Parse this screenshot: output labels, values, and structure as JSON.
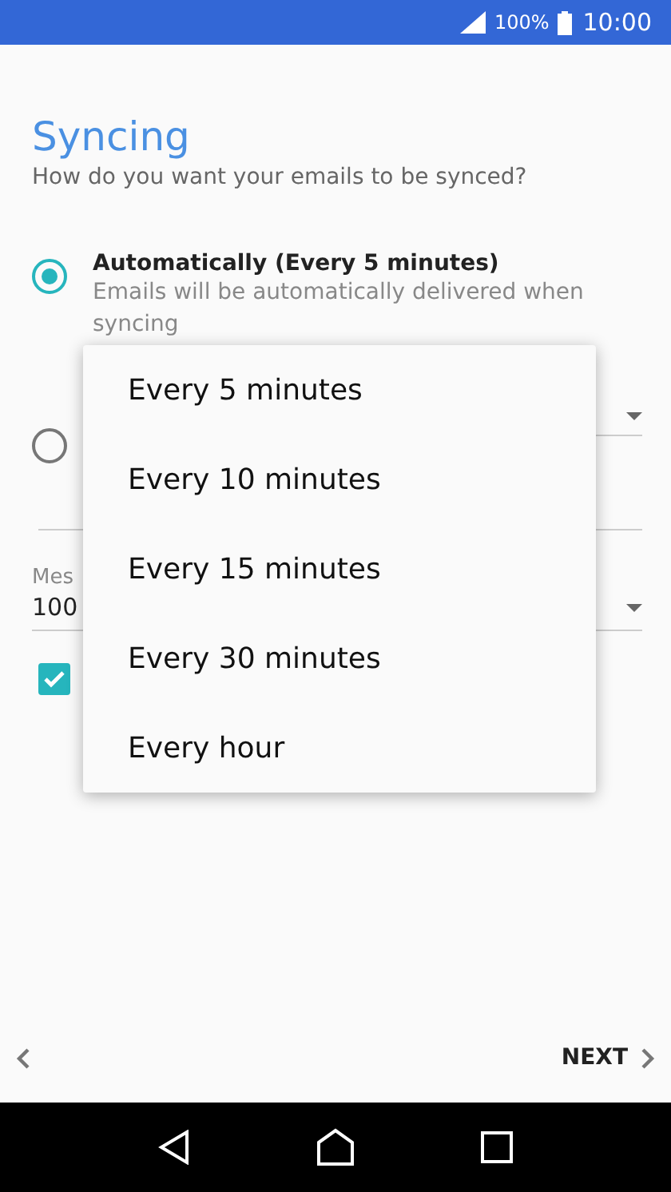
{
  "status_bar": {
    "battery": "100%",
    "time": "10:00"
  },
  "title": "Syncing",
  "subtitle": "How do you want your emails to be synced?",
  "options": [
    {
      "label": "Automatically (Every 5 minutes)",
      "description": "Emails will be automatically delivered when syncing",
      "selected": true
    },
    {
      "selected": false
    }
  ],
  "message_field": {
    "label": "Mes",
    "value": "100"
  },
  "checkbox": {
    "checked": true
  },
  "menu": [
    {
      "label": "Every 5 minutes"
    },
    {
      "label": "Every 10 minutes"
    },
    {
      "label": "Every 15 minutes"
    },
    {
      "label": "Every 30 minutes"
    },
    {
      "label": "Every hour"
    }
  ],
  "footer": {
    "next": "NEXT"
  }
}
